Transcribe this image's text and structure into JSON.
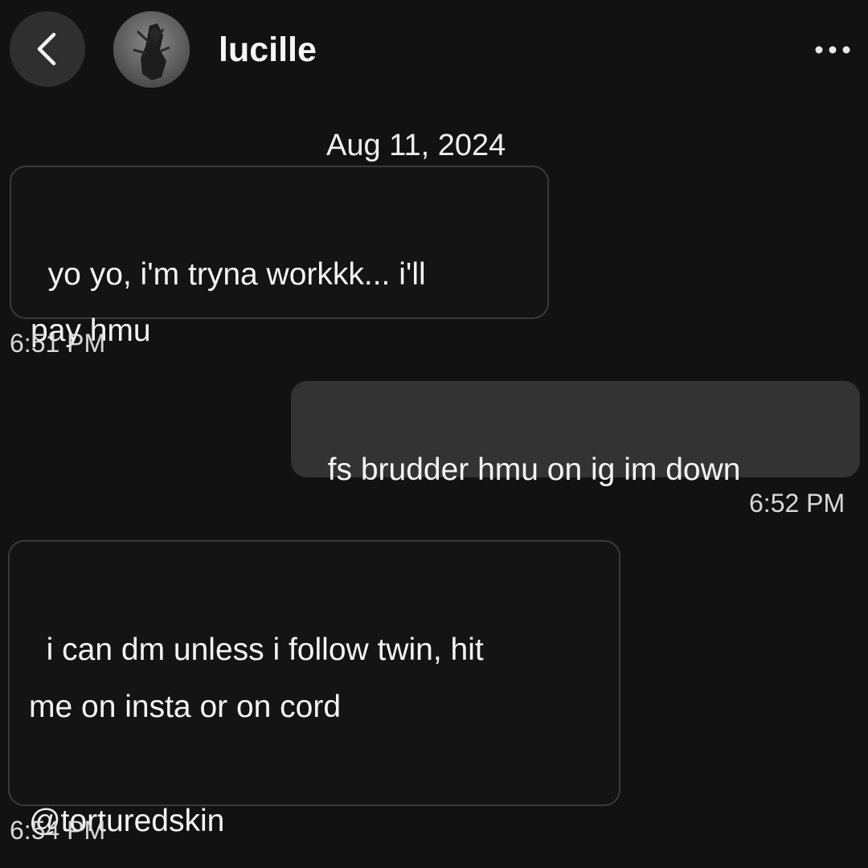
{
  "header": {
    "username": "lucille",
    "back_icon": "chevron-left-icon",
    "more_icon": "more-horizontal-icon"
  },
  "conversation": {
    "date": "Aug 11, 2024",
    "messages": [
      {
        "direction": "incoming",
        "text": "yo yo, i'm tryna workkk... i'll\npay hmu",
        "time": "6:51 PM"
      },
      {
        "direction": "outgoing",
        "text": "fs brudder hmu on ig im down",
        "time": "6:52 PM"
      },
      {
        "direction": "incoming",
        "text": "i can dm unless i follow twin, hit\nme on insta or on cord\n\n@torturedskin",
        "time": "6:54 PM"
      }
    ]
  },
  "colors": {
    "background": "#121212",
    "outgoing_bubble": "#333333",
    "incoming_border": "#3a3a3a",
    "back_button": "#2f2f2f"
  }
}
